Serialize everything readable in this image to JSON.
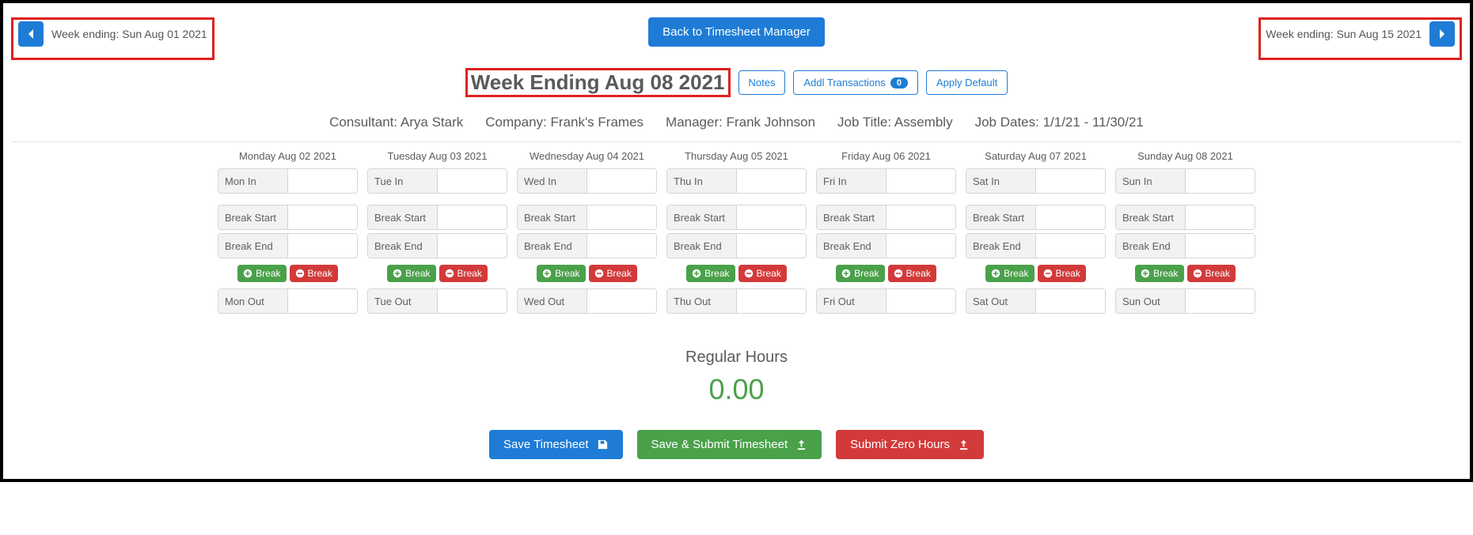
{
  "nav": {
    "prev_label": "Week ending: Sun Aug 01 2021",
    "next_label": "Week ending: Sun Aug 15 2021",
    "back_button": "Back to Timesheet Manager"
  },
  "title": "Week Ending Aug 08 2021",
  "toolbar": {
    "notes": "Notes",
    "addl_transactions": "Addl Transactions",
    "addl_transactions_count": "0",
    "apply_default": "Apply Default"
  },
  "info": {
    "consultant_label": "Consultant:",
    "consultant_value": "Arya Stark",
    "company_label": "Company:",
    "company_value": "Frank's Frames",
    "manager_label": "Manager:",
    "manager_value": "Frank Johnson",
    "job_title_label": "Job Title:",
    "job_title_value": "Assembly",
    "job_dates_label": "Job Dates:",
    "job_dates_value": "1/1/21 - 11/30/21"
  },
  "field_labels": {
    "break_start": "Break Start",
    "break_end": "Break End",
    "add_break": "Break",
    "remove_break": "Break"
  },
  "days": [
    {
      "header": "Monday Aug 02 2021",
      "in_label": "Mon In",
      "out_label": "Mon Out",
      "in_value": "",
      "break_start_value": "",
      "break_end_value": "",
      "out_value": ""
    },
    {
      "header": "Tuesday Aug 03 2021",
      "in_label": "Tue In",
      "out_label": "Tue Out",
      "in_value": "",
      "break_start_value": "",
      "break_end_value": "",
      "out_value": ""
    },
    {
      "header": "Wednesday Aug 04 2021",
      "in_label": "Wed In",
      "out_label": "Wed Out",
      "in_value": "",
      "break_start_value": "",
      "break_end_value": "",
      "out_value": ""
    },
    {
      "header": "Thursday Aug 05 2021",
      "in_label": "Thu In",
      "out_label": "Thu Out",
      "in_value": "",
      "break_start_value": "",
      "break_end_value": "",
      "out_value": ""
    },
    {
      "header": "Friday Aug 06 2021",
      "in_label": "Fri In",
      "out_label": "Fri Out",
      "in_value": "",
      "break_start_value": "",
      "break_end_value": "",
      "out_value": ""
    },
    {
      "header": "Saturday Aug 07 2021",
      "in_label": "Sat In",
      "out_label": "Sat Out",
      "in_value": "",
      "break_start_value": "",
      "break_end_value": "",
      "out_value": ""
    },
    {
      "header": "Sunday Aug 08 2021",
      "in_label": "Sun In",
      "out_label": "Sun Out",
      "in_value": "",
      "break_start_value": "",
      "break_end_value": "",
      "out_value": ""
    }
  ],
  "totals": {
    "label": "Regular Hours",
    "value": "0.00"
  },
  "actions": {
    "save": "Save Timesheet",
    "save_submit": "Save & Submit Timesheet",
    "submit_zero": "Submit Zero Hours"
  }
}
